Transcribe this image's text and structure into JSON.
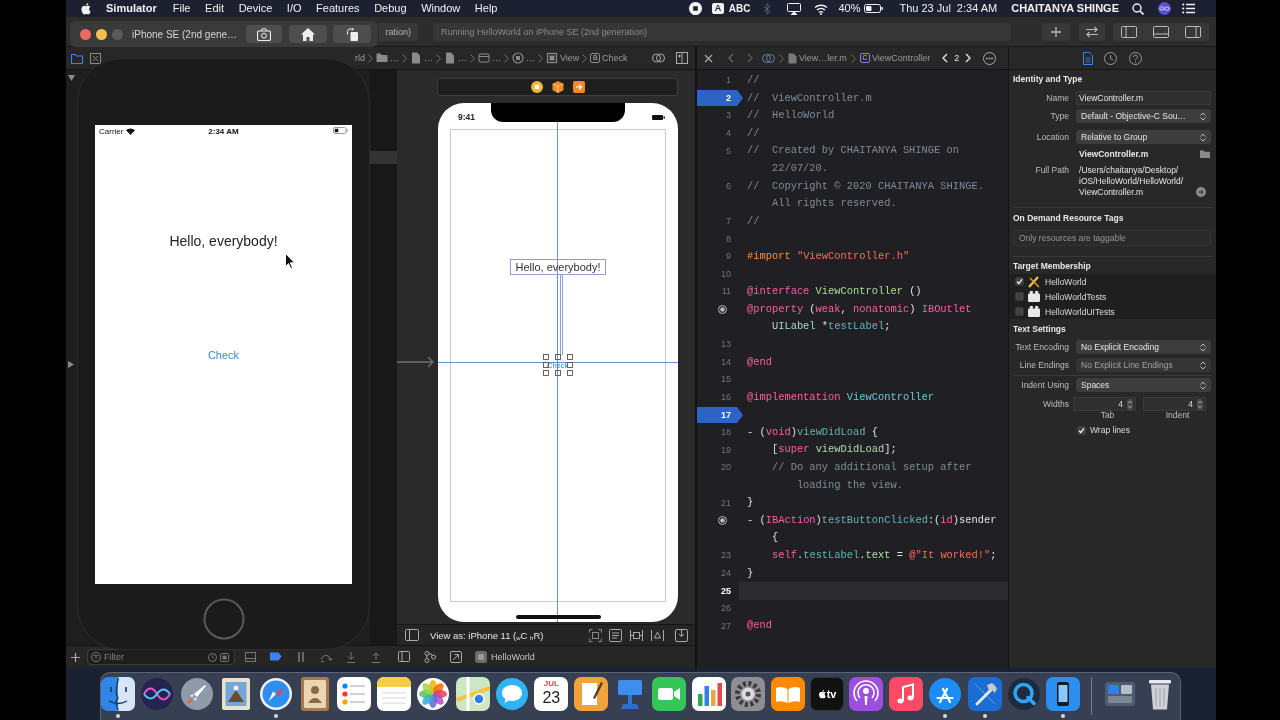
{
  "menu_bar": {
    "app_name": "Simulator",
    "menus": [
      "File",
      "Edit",
      "Device",
      "I/O",
      "Features",
      "Debug",
      "Window",
      "Help"
    ],
    "input_source": {
      "badge": "A",
      "name": "ABC"
    },
    "battery": "40%",
    "date": "Thu 23 Jul",
    "time": "2:34 AM",
    "user": "CHAITANYA SHINGE"
  },
  "simulator": {
    "title": "iPhone SE (2nd gene…",
    "screen": {
      "carrier": "Carrier",
      "time": "2:34 AM",
      "label": "Hello, everybody!",
      "button": "Check"
    }
  },
  "toolbar": {
    "scheme": "ration)",
    "activity": "Running HelloWorld on iPhone SE (2nd generation)"
  },
  "storyboard_jump_bar": [
    {
      "kind": "plain",
      "text": "rld"
    },
    {
      "kind": "folder",
      "text": "…"
    },
    {
      "kind": "file",
      "text": "…"
    },
    {
      "kind": "file",
      "text": "…"
    },
    {
      "kind": "scene",
      "text": "…"
    },
    {
      "kind": "controller",
      "text": "…"
    },
    {
      "kind": "view",
      "text": "View"
    },
    {
      "kind": "badge",
      "badge": "B",
      "text": "Check"
    }
  ],
  "editor_jump_bar": {
    "file": "View…ler.m",
    "class_badge": "C",
    "symbol": "ViewController",
    "change_index": "2"
  },
  "inspector_tabs": [
    {
      "kind": "file",
      "selected": true
    },
    {
      "kind": "history",
      "selected": false
    },
    {
      "kind": "help",
      "selected": false
    }
  ],
  "storyboard": {
    "status_time": "9:41",
    "label": "Hello, everybody!",
    "button": {
      "title": "Check",
      "selected": true
    },
    "view_as": "View as: iPhone 11 ($_{w}$C $_{h}$R)"
  },
  "code": {
    "lines": [
      {
        "number": "1",
        "tokens": [
          {
            "kind": "comment",
            "text": "//"
          }
        ],
        "breakpoint": false,
        "connected": false,
        "current": false
      },
      {
        "number": "2",
        "tokens": [
          {
            "kind": "comment",
            "text": "//  ViewController.m"
          }
        ],
        "breakpoint": true,
        "connected": false,
        "current": false
      },
      {
        "number": "3",
        "tokens": [
          {
            "kind": "comment",
            "text": "//  HelloWorld"
          }
        ],
        "breakpoint": false,
        "connected": false,
        "current": false
      },
      {
        "number": "4",
        "tokens": [
          {
            "kind": "comment",
            "text": "//"
          }
        ],
        "breakpoint": false,
        "connected": false,
        "current": false
      },
      {
        "number": "5",
        "tokens": [
          {
            "kind": "comment",
            "text": "//  Created by CHAITANYA SHINGE on 22/07/20."
          }
        ],
        "breakpoint": false,
        "connected": false,
        "current": false
      },
      {
        "number": "6",
        "tokens": [
          {
            "kind": "comment",
            "text": "//  Copyright © 2020 CHAITANYA SHINGE. All rights reserved."
          }
        ],
        "breakpoint": false,
        "connected": false,
        "current": false
      },
      {
        "number": "7",
        "tokens": [
          {
            "kind": "comment",
            "text": "//"
          }
        ],
        "breakpoint": false,
        "connected": false,
        "current": false
      },
      {
        "number": "8",
        "breakpoint": false,
        "connected": false,
        "current": false
      },
      {
        "number": "9",
        "tokens": [
          {
            "kind": "preprocessor",
            "text": "#import "
          },
          {
            "kind": "string",
            "text": "\"ViewController.h\""
          }
        ],
        "breakpoint": false,
        "connected": false,
        "current": false
      },
      {
        "number": "10",
        "breakpoint": false,
        "connected": false,
        "current": false
      },
      {
        "number": "11",
        "tokens": [
          {
            "kind": "keyword",
            "text": "@interface "
          },
          {
            "kind": "class_decl",
            "text": "ViewController"
          },
          {
            "kind": "plain",
            "text": " ()"
          }
        ],
        "breakpoint": false,
        "connected": false,
        "current": false
      },
      {
        "tokens": [
          {
            "kind": "keyword",
            "text": "@property"
          },
          {
            "kind": "plain",
            "text": " ("
          },
          {
            "kind": "keyword",
            "text": "weak"
          },
          {
            "kind": "plain",
            "text": ", "
          },
          {
            "kind": "keyword",
            "text": "nonatomic"
          },
          {
            "kind": "plain",
            "text": ") "
          },
          {
            "kind": "keyword",
            "text": "IBOutlet "
          },
          {
            "kind": "type",
            "text": "UILabel"
          },
          {
            "kind": "plain",
            "text": " *"
          },
          {
            "kind": "property",
            "text": "testLabel"
          },
          {
            "kind": "plain",
            "text": ";"
          }
        ],
        "breakpoint": false,
        "connected": true,
        "current": false
      },
      {
        "number": "13",
        "breakpoint": false,
        "connected": false,
        "current": false
      },
      {
        "number": "14",
        "tokens": [
          {
            "kind": "keyword",
            "text": "@end"
          }
        ],
        "breakpoint": false,
        "connected": false,
        "current": false
      },
      {
        "number": "15",
        "breakpoint": false,
        "connected": false,
        "current": false
      },
      {
        "number": "16",
        "tokens": [
          {
            "kind": "keyword",
            "text": "@implementation "
          },
          {
            "kind": "class_ref",
            "text": "ViewController"
          }
        ],
        "breakpoint": false,
        "connected": false,
        "current": false
      },
      {
        "number": "17",
        "breakpoint": true,
        "connected": false,
        "current": false
      },
      {
        "number": "18",
        "tokens": [
          {
            "kind": "plain",
            "text": "- ("
          },
          {
            "kind": "keyword",
            "text": "void"
          },
          {
            "kind": "plain",
            "text": ")"
          },
          {
            "kind": "method_decl",
            "text": "viewDidLoad"
          },
          {
            "kind": "plain",
            "text": " {"
          }
        ],
        "breakpoint": false,
        "connected": false,
        "current": false
      },
      {
        "number": "19",
        "tokens": [
          {
            "kind": "plain",
            "text": "    ["
          },
          {
            "kind": "keyword",
            "text": "super "
          },
          {
            "kind": "system",
            "text": "viewDidLoad"
          },
          {
            "kind": "plain",
            "text": "];"
          }
        ],
        "breakpoint": false,
        "connected": false,
        "current": false
      },
      {
        "number": "20",
        "tokens": [
          {
            "kind": "comment",
            "text": "    // Do any additional setup after loading the view."
          }
        ],
        "breakpoint": false,
        "connected": false,
        "current": false
      },
      {
        "number": "21",
        "tokens": [
          {
            "kind": "plain",
            "text": "}"
          }
        ],
        "breakpoint": false,
        "connected": false,
        "current": false
      },
      {
        "tokens": [
          {
            "kind": "plain",
            "text": "- ("
          },
          {
            "kind": "keyword",
            "text": "IBAction"
          },
          {
            "kind": "plain",
            "text": ")"
          },
          {
            "kind": "method_decl",
            "text": "testButtonClicked"
          },
          {
            "kind": "plain",
            "text": ":("
          },
          {
            "kind": "keyword",
            "text": "id"
          },
          {
            "kind": "plain",
            "text": ")sender {"
          }
        ],
        "breakpoint": false,
        "connected": true,
        "current": false
      },
      {
        "number": "23",
        "tokens": [
          {
            "kind": "keyword",
            "text": "    self"
          },
          {
            "kind": "plain",
            "text": "."
          },
          {
            "kind": "property",
            "text": "testLabel"
          },
          {
            "kind": "plain",
            "text": "."
          },
          {
            "kind": "system",
            "text": "text"
          },
          {
            "kind": "plain",
            "text": " = "
          },
          {
            "kind": "string",
            "text": "@\"It worked!\""
          },
          {
            "kind": "plain",
            "text": ";"
          }
        ],
        "breakpoint": false,
        "connected": false,
        "current": false
      },
      {
        "number": "24",
        "tokens": [
          {
            "kind": "plain",
            "text": "}"
          }
        ],
        "breakpoint": false,
        "connected": false,
        "current": false
      },
      {
        "number": "25",
        "breakpoint": false,
        "connected": false,
        "current": true
      },
      {
        "number": "26",
        "breakpoint": false,
        "connected": false,
        "current": false
      },
      {
        "number": "27",
        "tokens": [
          {
            "kind": "keyword",
            "text": "@end"
          }
        ],
        "breakpoint": false,
        "connected": false,
        "current": false
      }
    ]
  },
  "inspector": {
    "identity": {
      "title": "Identity and Type",
      "rows": [
        {
          "label": "Name",
          "kind": "field",
          "value": "ViewController.m"
        },
        {
          "label": "Type",
          "kind": "popup",
          "value": "Default - Objective-C Sou…"
        },
        {
          "label": "Location",
          "kind": "popup",
          "value": "Relative to Group"
        }
      ],
      "file_name": "ViewController.m",
      "full_path_label": "Full Path",
      "full_path": "/Users/chaitanya/Desktop/iOS/HelloWorld/HelloWorld/ViewController.m"
    },
    "tags": {
      "title": "On Demand Resource Tags",
      "placeholder": "Only resources are taggable"
    },
    "membership": {
      "title": "Target Membership",
      "targets": [
        {
          "name": "HelloWorld",
          "kind": "app",
          "checked": true
        },
        {
          "name": "HelloWorldTests",
          "kind": "bundle",
          "checked": false
        },
        {
          "name": "HelloWorldUITests",
          "kind": "bundle",
          "checked": false
        }
      ]
    },
    "text_settings": {
      "title": "Text Settings",
      "rows": [
        {
          "label": "Text Encoding",
          "value": "No Explicit Encoding",
          "disabled": false
        },
        {
          "label": "Line Endings",
          "value": "No Explicit Line Endings",
          "disabled": true
        },
        {
          "label": "Indent Using",
          "value": "Spaces",
          "disabled": false
        }
      ],
      "widths_label": "Widths",
      "tab": {
        "value": "4",
        "caption": "Tab"
      },
      "indent": {
        "value": "4",
        "caption": "Indent"
      },
      "wrap_lines": {
        "label": "Wrap lines",
        "checked": true
      }
    }
  },
  "bottom_bar": {
    "filter_placeholder": "Filter",
    "process": "HelloWorld"
  },
  "dock": {
    "apps": [
      {
        "kind": "finder",
        "running": true
      },
      {
        "kind": "siri",
        "running": false
      },
      {
        "kind": "launchpad",
        "running": false
      },
      {
        "kind": "mail",
        "running": false
      },
      {
        "kind": "safari",
        "running": true
      },
      {
        "kind": "contacts",
        "running": false
      },
      {
        "kind": "reminders",
        "running": false
      },
      {
        "kind": "notes",
        "running": false
      },
      {
        "kind": "photos",
        "running": false
      },
      {
        "kind": "maps",
        "running": false
      },
      {
        "kind": "messages",
        "running": false
      },
      {
        "kind": "calendar",
        "month": "JUL",
        "day": "23",
        "running": false
      },
      {
        "kind": "pages",
        "running": false
      },
      {
        "kind": "keynote",
        "running": false
      },
      {
        "kind": "facetime",
        "running": false
      },
      {
        "kind": "numbers",
        "running": false
      },
      {
        "kind": "preferences",
        "running": false
      },
      {
        "kind": "books",
        "running": false
      },
      {
        "kind": "tv",
        "text": "tv",
        "running": false
      },
      {
        "kind": "podcasts",
        "running": false
      },
      {
        "kind": "music",
        "running": false
      },
      {
        "kind": "appstore",
        "running": true
      },
      {
        "kind": "xcode",
        "running": true
      },
      {
        "kind": "quicktime",
        "running": false
      },
      {
        "kind": "simulator",
        "running": true
      }
    ],
    "stacks": [
      {
        "kind": "downloads"
      },
      {
        "kind": "trash"
      }
    ]
  }
}
